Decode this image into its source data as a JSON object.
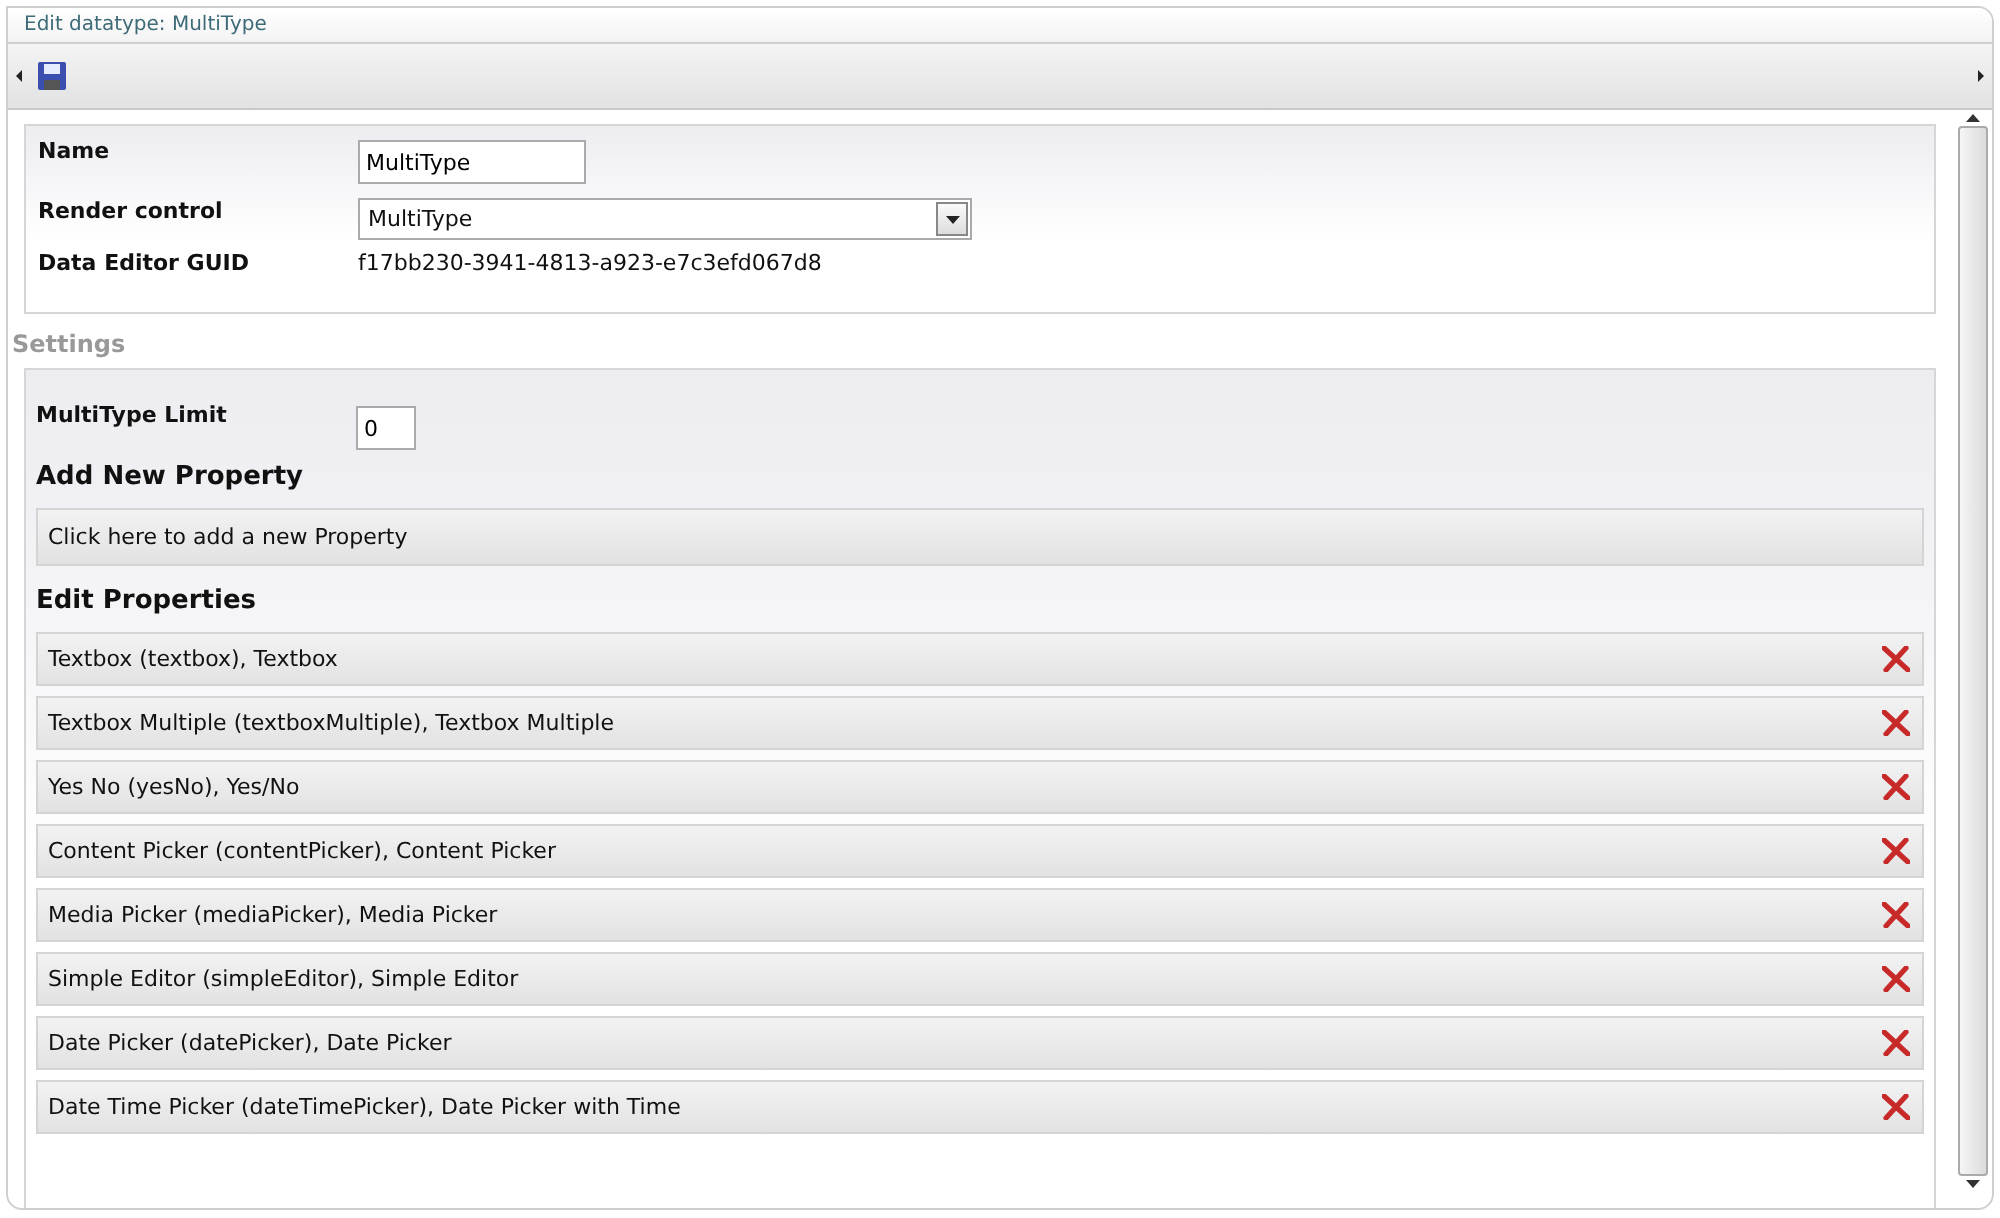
{
  "window": {
    "title": "Edit datatype: MultiType"
  },
  "fields": {
    "name": {
      "label": "Name",
      "value": "MultiType"
    },
    "render_control": {
      "label": "Render control",
      "value": "MultiType"
    },
    "guid": {
      "label": "Data Editor GUID",
      "value": "f17bb230-3941-4813-a923-e7c3efd067d8"
    }
  },
  "settings": {
    "heading": "Settings",
    "limit": {
      "label": "MultiType Limit",
      "value": "0"
    },
    "add_heading": "Add New Property",
    "add_button": "Click here to add a new Property",
    "edit_heading": "Edit Properties",
    "properties": [
      {
        "label": "Textbox (textbox), Textbox"
      },
      {
        "label": "Textbox Multiple (textboxMultiple), Textbox Multiple"
      },
      {
        "label": "Yes No (yesNo), Yes/No"
      },
      {
        "label": "Content Picker (contentPicker), Content Picker"
      },
      {
        "label": "Media Picker (mediaPicker), Media Picker"
      },
      {
        "label": "Simple Editor (simpleEditor), Simple Editor"
      },
      {
        "label": "Date Picker (datePicker), Date Picker"
      },
      {
        "label": "Date Time Picker (dateTimePicker), Date Picker with Time"
      }
    ]
  }
}
